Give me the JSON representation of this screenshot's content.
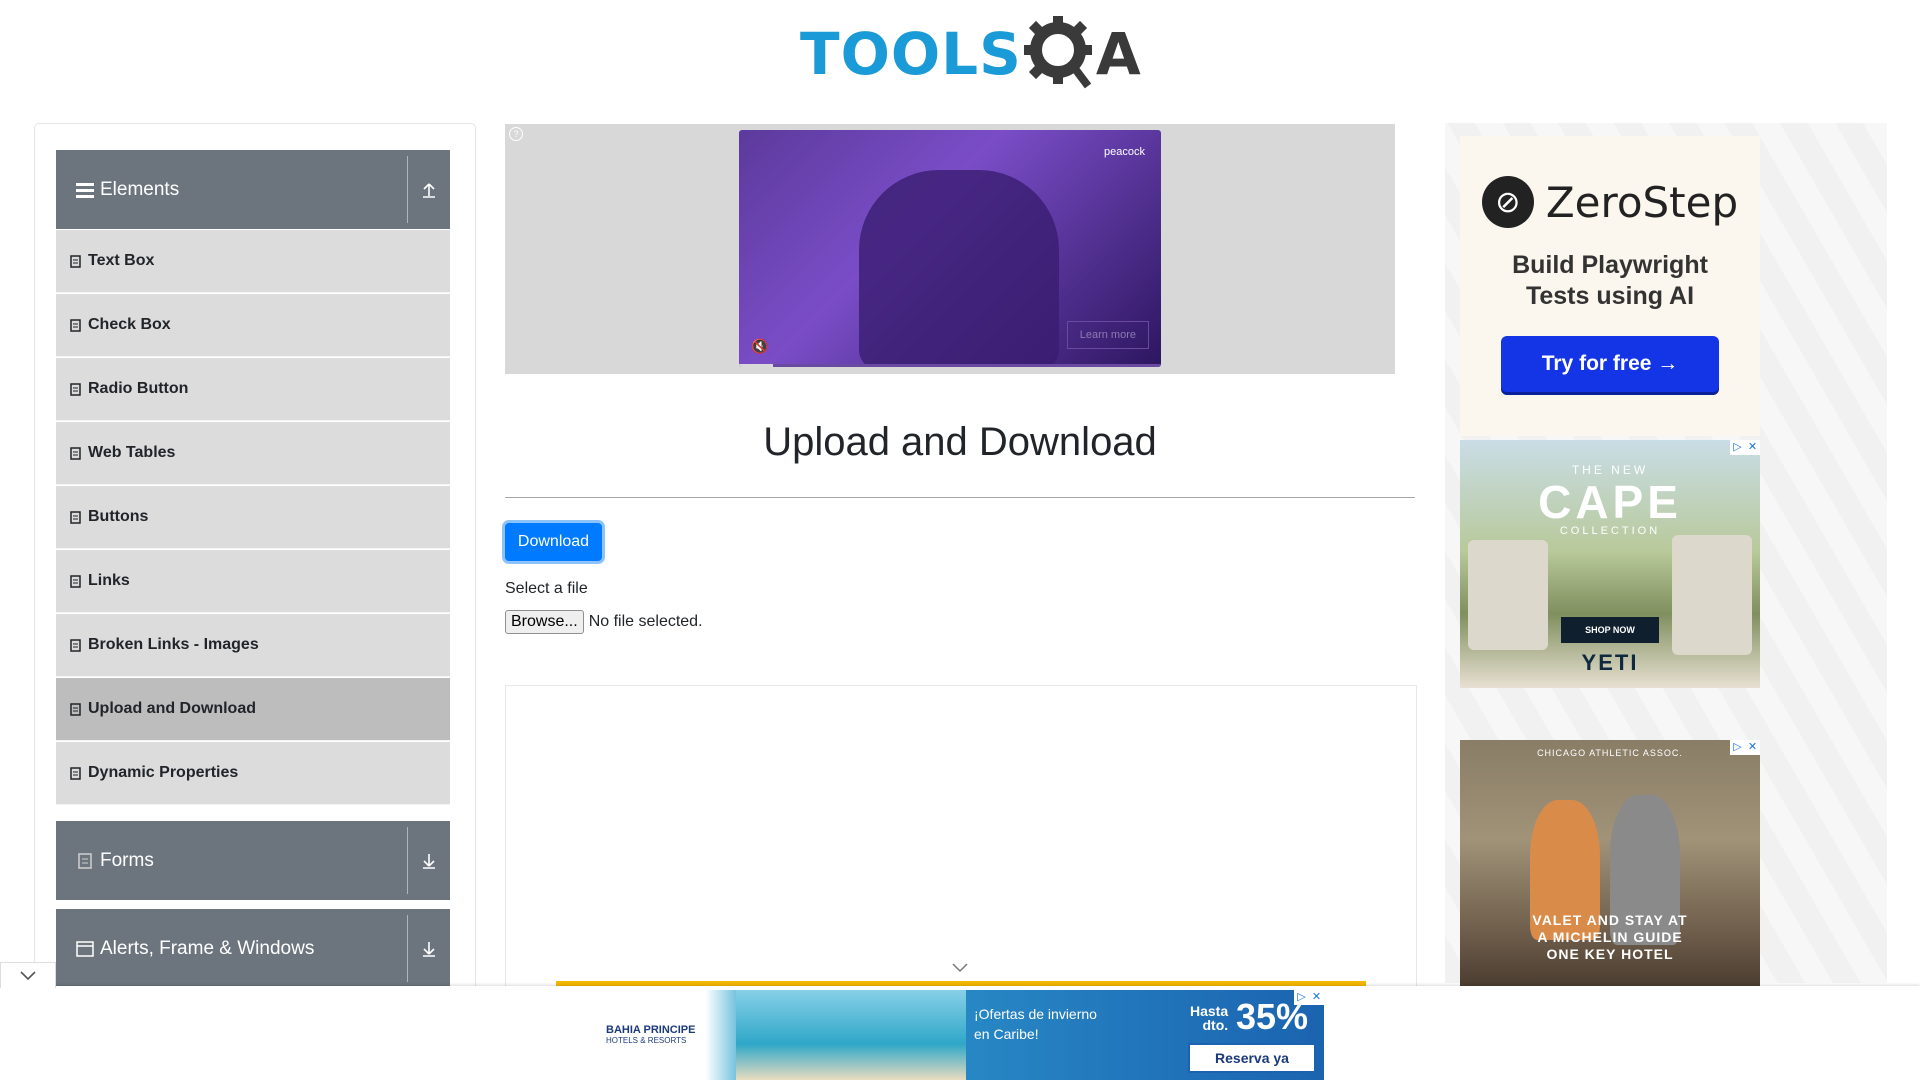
{
  "header": {
    "logo_tools": "TOOLS",
    "logo_q": "Q",
    "logo_a": "A"
  },
  "sidebar": {
    "groups": [
      {
        "title": "Elements",
        "icon": "hamburger-icon",
        "toggle_icon": "arrow-up-icon"
      },
      {
        "title": "Forms",
        "icon": "document-icon",
        "toggle_icon": "arrow-down-icon"
      },
      {
        "title": "Alerts, Frame & Windows",
        "icon": "window-icon",
        "toggle_icon": "arrow-down-icon"
      }
    ],
    "items": [
      {
        "label": "Text Box"
      },
      {
        "label": "Check Box"
      },
      {
        "label": "Radio Button"
      },
      {
        "label": "Web Tables"
      },
      {
        "label": "Buttons"
      },
      {
        "label": "Links"
      },
      {
        "label": "Broken Links - Images"
      },
      {
        "label": "Upload and Download",
        "active": true
      },
      {
        "label": "Dynamic Properties"
      }
    ]
  },
  "video_ad": {
    "brand": "peacock",
    "cta": "Learn more"
  },
  "main": {
    "title": "Upload and Download",
    "download_button": "Download",
    "file_label": "Select a file",
    "browse_button": "Browse...",
    "file_status": "No file selected."
  },
  "right_ads": {
    "zerostep": {
      "name": "ZeroStep",
      "tagline_1": "Build Playwright",
      "tagline_2": "Tests using AI",
      "cta": "Try for free →"
    },
    "yeti": {
      "line1": "THE NEW",
      "line2": "CAPE",
      "line3": "COLLECTION",
      "cta": "SHOP NOW",
      "brand": "YETI"
    },
    "chicago": {
      "brand": "CHICAGO ATHLETIC ASSOC.",
      "line1": "VALET AND STAY AT",
      "line2": "A MICHELIN GUIDE",
      "line3": "ONE KEY HOTEL"
    }
  },
  "bottom_ad": {
    "brand": "BAHIA PRINCIPE",
    "brand_sub": "HOTELS & RESORTS",
    "offer_1": "¡Ofertas de invierno",
    "offer_2": "en Caribe!",
    "hasta_1": "Hasta",
    "hasta_2": "dto.",
    "percent": "35%",
    "cta": "Reserva ya"
  },
  "colors": {
    "sidebar_header": "#6c757d",
    "menu_item": "#dcdcdc",
    "menu_active": "#bdbdbd",
    "primary": "#007bff",
    "logo_blue": "#1a9ad6"
  }
}
